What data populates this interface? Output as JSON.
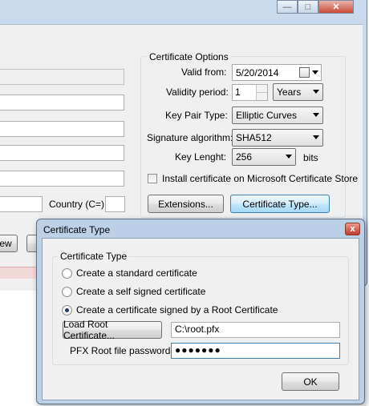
{
  "main_window": {
    "title_buttons": {
      "minimize": "—",
      "maximize": "□",
      "close": "✕"
    },
    "left_fields": {
      "country_label": "Country (C=):",
      "country_value": "",
      "partial_button_label": "ew"
    },
    "certificate_options": {
      "title": "Certificate Options",
      "valid_from_label": "Valid from:",
      "valid_from_value": "5/20/2014",
      "validity_period_label": "Validity period:",
      "validity_period_value": "1",
      "validity_period_unit": "Years",
      "key_pair_type_label": "Key Pair Type:",
      "key_pair_type_value": "Elliptic Curves",
      "signature_algorithm_label": "Signature algorithm:",
      "signature_algorithm_value": "SHA512",
      "key_length_label": "Key Lenght:",
      "key_length_value": "256",
      "key_length_unit": "bits",
      "install_cert_label": "Install certificate on Microsoft Certificate Store",
      "install_cert_checked": false,
      "extensions_button": "Extensions...",
      "certificate_type_button": "Certificate Type..."
    }
  },
  "dialog": {
    "title": "Certificate Type",
    "close_glyph": "x",
    "group_title": "Certificate Type",
    "options": [
      {
        "label": "Create a standard certificate",
        "selected": false
      },
      {
        "label": "Create a self signed certificate",
        "selected": false
      },
      {
        "label": "Create a certificate signed by a Root Certificate",
        "selected": true
      }
    ],
    "load_root_button": "Load Root Certificate...",
    "root_path_value": "C:\\root.pfx",
    "pfx_password_label": "PFX Root file password:",
    "pfx_password_value": "●●●●●●●",
    "ok_button": "OK"
  },
  "colors": {
    "accent": "#3c7fb1",
    "window_frame": "#c9d9ee",
    "client_bg": "#f0f0f0",
    "close_red": "#c0392b"
  }
}
